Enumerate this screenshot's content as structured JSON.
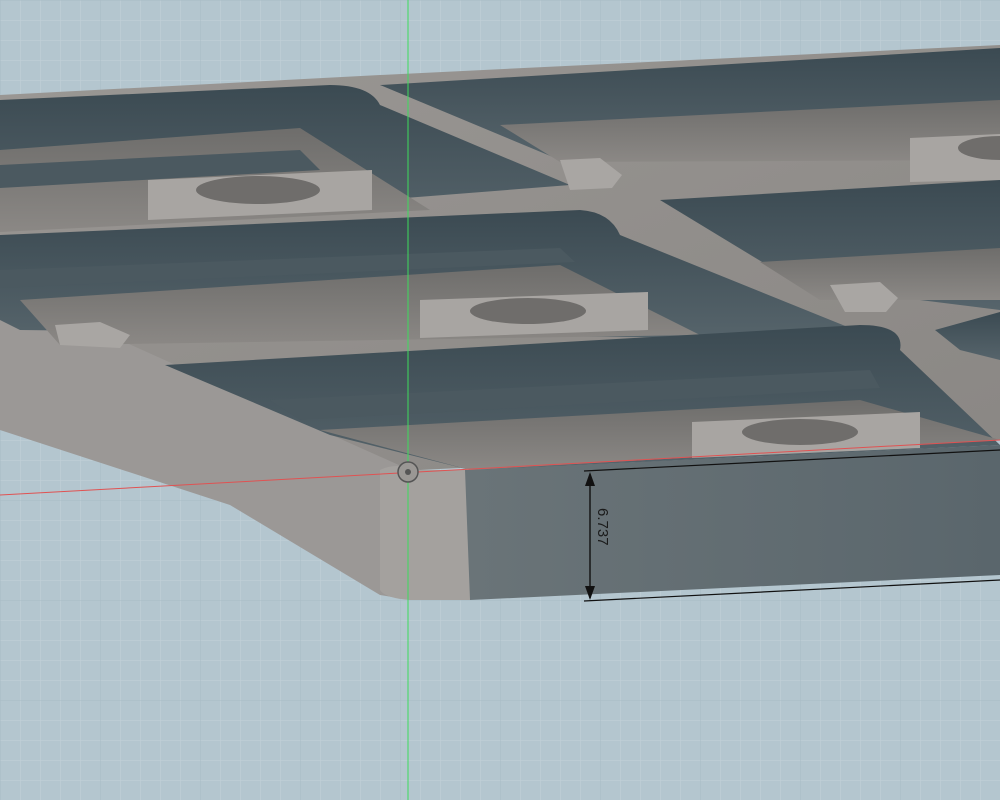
{
  "viewport": {
    "background_color": "#b4c6cf",
    "grid_minor_color": "#c7d4db",
    "grid_major_color": "#9fb2bc"
  },
  "axes": {
    "x_axis_color": "#e05252",
    "z_axis_color": "#3ddc5c"
  },
  "model": {
    "body_color": "#8f8d8b",
    "face_light_color": "#a5a29f",
    "pocket_dark_color": "#3f5058",
    "pocket_floor_color": "#5a5d5f",
    "side_face_color": "#5e6a70"
  },
  "dimension": {
    "value": "6.737",
    "line_color": "#111111"
  },
  "origin_marker": {
    "icon": "origin-point-icon"
  }
}
